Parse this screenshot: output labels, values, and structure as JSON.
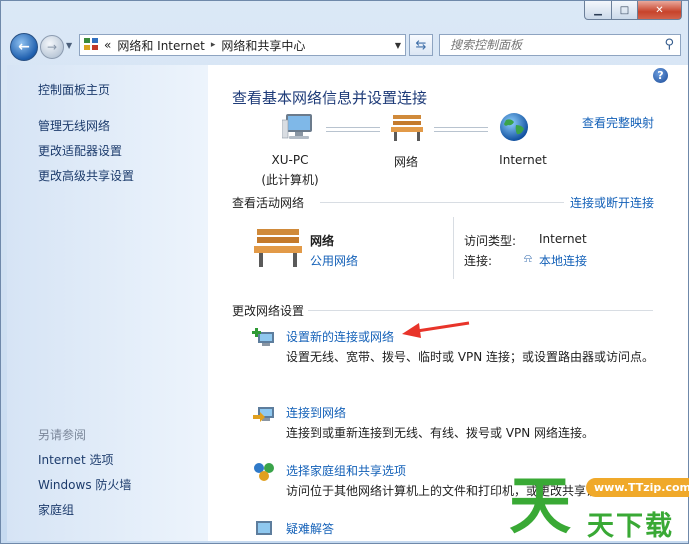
{
  "window": {
    "buttons": {
      "minimize": "▁",
      "maximize": "□",
      "close": "✕"
    }
  },
  "nav": {
    "back": "←",
    "forward": "→",
    "breadcrumb": [
      "«",
      "网络和 Internet",
      "▸",
      "网络和共享中心"
    ],
    "search_placeholder": "搜索控制面板"
  },
  "sidebar": {
    "home": "控制面板主页",
    "items": [
      "管理无线网络",
      "更改适配器设置",
      "更改高级共享设置"
    ],
    "see_also_header": "另请参阅",
    "see_also": [
      "Internet 选项",
      "Windows 防火墙",
      "家庭组"
    ]
  },
  "main": {
    "title": "查看基本网络信息并设置连接",
    "full_map_link": "查看完整映射",
    "map": {
      "computer_name": "XU-PC",
      "computer_sub": "(此计算机)",
      "network": "网络",
      "internet": "Internet"
    },
    "active": {
      "header": "查看活动网络",
      "toggle_link": "连接或断开连接",
      "network_name": "网络",
      "network_type": "公用网络",
      "access_label": "访问类型:",
      "access_value": "Internet",
      "conn_label": "连接:",
      "conn_value": "本地连接"
    },
    "settings": {
      "header": "更改网络设置",
      "tasks": [
        {
          "title": "设置新的连接或网络",
          "desc": "设置无线、宽带、拨号、临时或 VPN 连接；或设置路由器或访问点。"
        },
        {
          "title": "连接到网络",
          "desc": "连接到或重新连接到无线、有线、拨号或 VPN 网络连接。"
        },
        {
          "title": "选择家庭组和共享选项",
          "desc": "访问位于其他网络计算机上的文件和打印机，或更改共享设置。"
        },
        {
          "title": "疑难解答",
          "desc": ""
        }
      ]
    }
  },
  "watermark": {
    "url": "www.TTzip.com",
    "brand": "天下载",
    "logo_char": "天"
  },
  "colors": {
    "link": "#1461b8",
    "title": "#1e3b78",
    "arrow": "#e8342a",
    "watermark_green": "#39a935"
  }
}
